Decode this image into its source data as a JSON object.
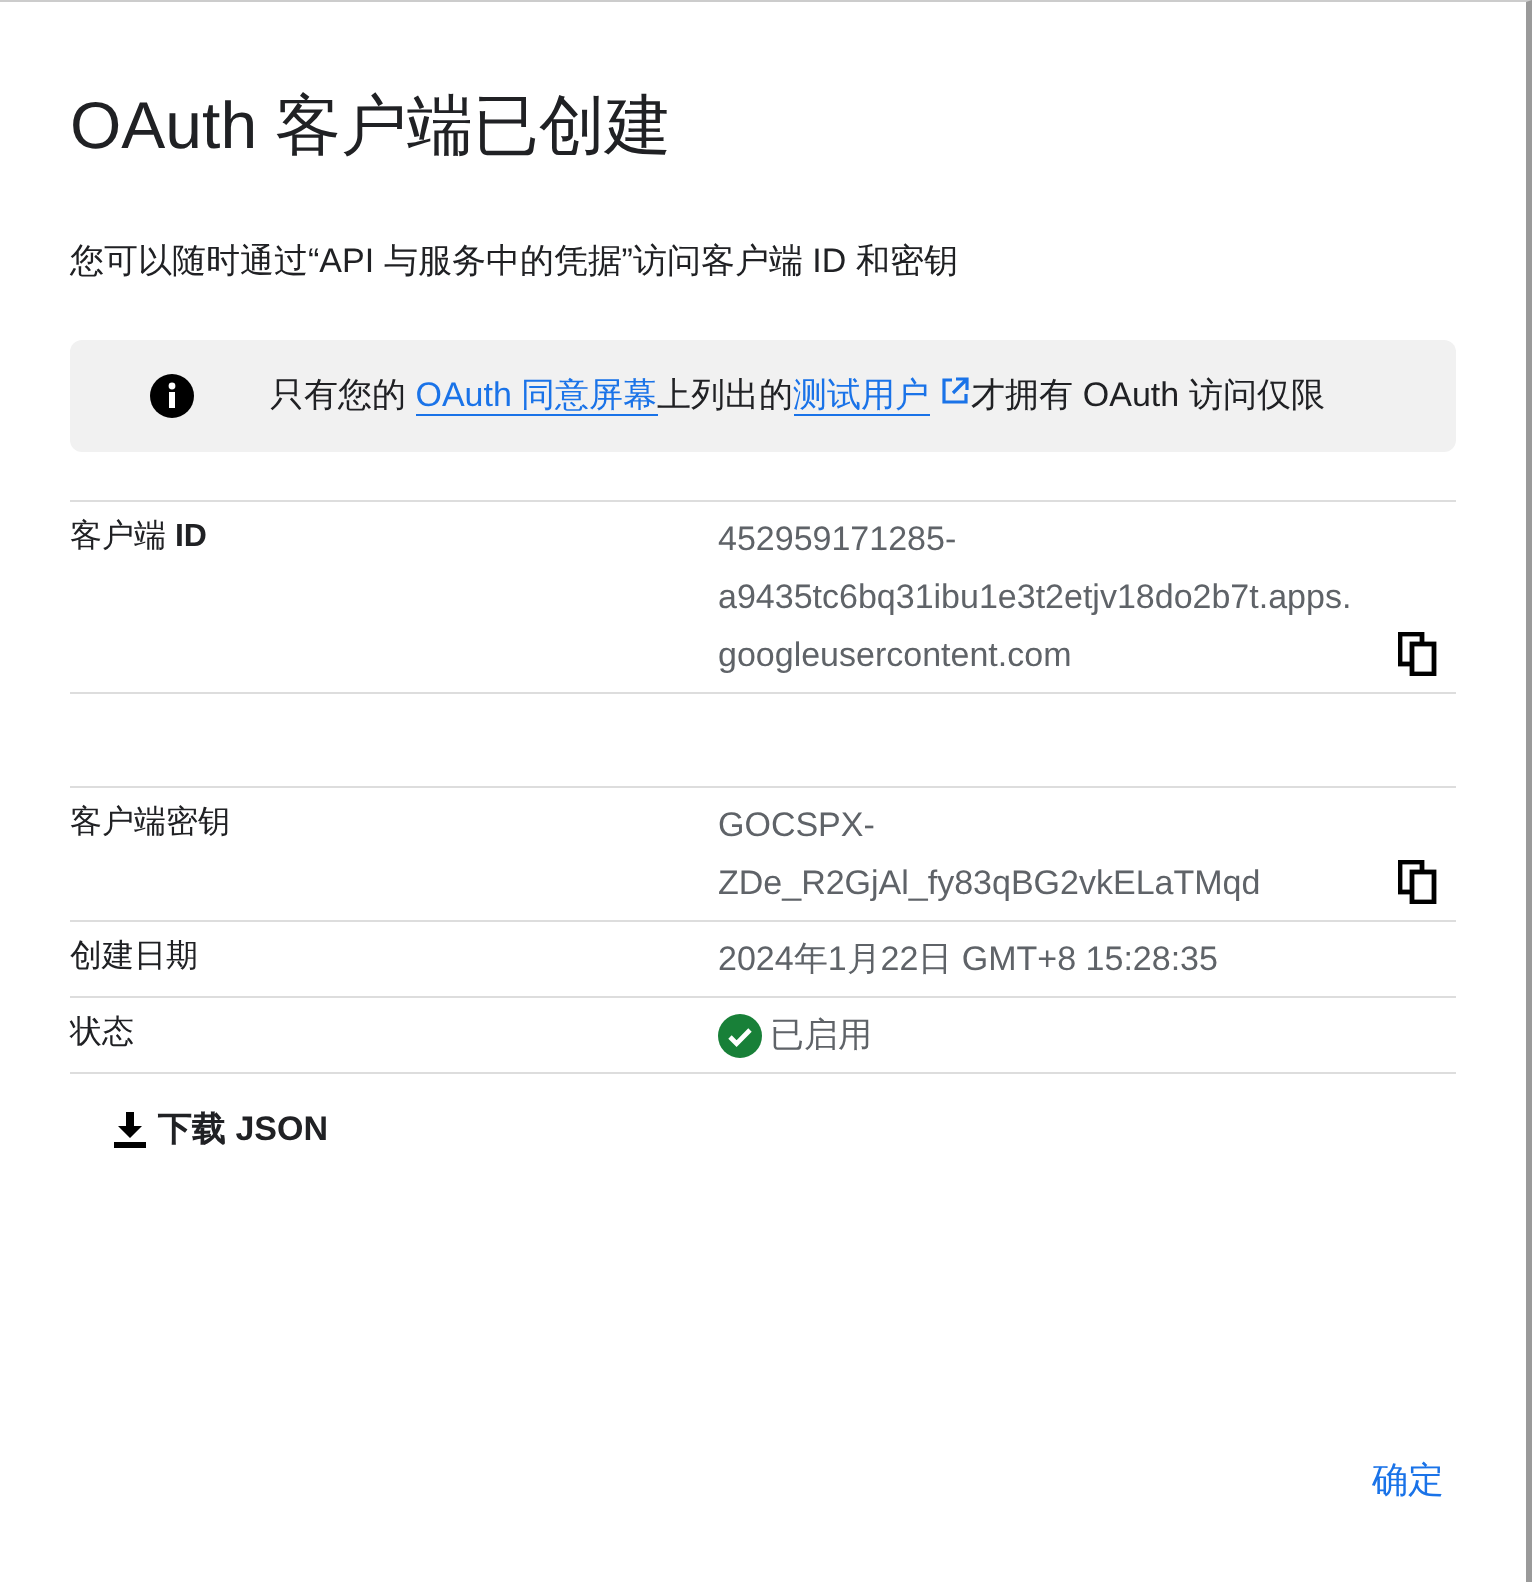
{
  "dialog": {
    "title": "OAuth 客户端已创建",
    "description": "您可以随时通过“API 与服务中的凭据”访问客户端 ID 和密钥"
  },
  "notice": {
    "parts": [
      {
        "kind": "text",
        "text": "只有您的 "
      },
      {
        "kind": "link",
        "text": "OAuth 同意屏幕"
      },
      {
        "kind": "text",
        "text": "上列出的"
      },
      {
        "kind": "external_link",
        "text": "测试用户"
      },
      {
        "kind": "text",
        "text": "才拥有 OAuth 访问仅限"
      }
    ]
  },
  "details": [
    {
      "kind": "copyable",
      "label": "客户端 **ID**",
      "value_lines": [
        "452959171285-",
        "a9435tc6bq31ibu1e3t2etjv18do2b7t.apps.",
        "googleusercontent.com"
      ]
    },
    {
      "kind": "spacer"
    },
    {
      "kind": "copyable",
      "label": "客户端密钥",
      "value_lines": [
        "GOCSPX-",
        "ZDe_R2GjAl_fy83qBG2vkELaTMqd"
      ]
    },
    {
      "kind": "text",
      "label": "创建日期",
      "value_lines": [
        "2024年1月22日 GMT+8 15:28:35"
      ]
    },
    {
      "kind": "status",
      "label": "状态",
      "value_lines": [
        "已启用"
      ],
      "enabled": true
    }
  ],
  "download_button": "下载 JSON",
  "confirm_button": "确定"
}
